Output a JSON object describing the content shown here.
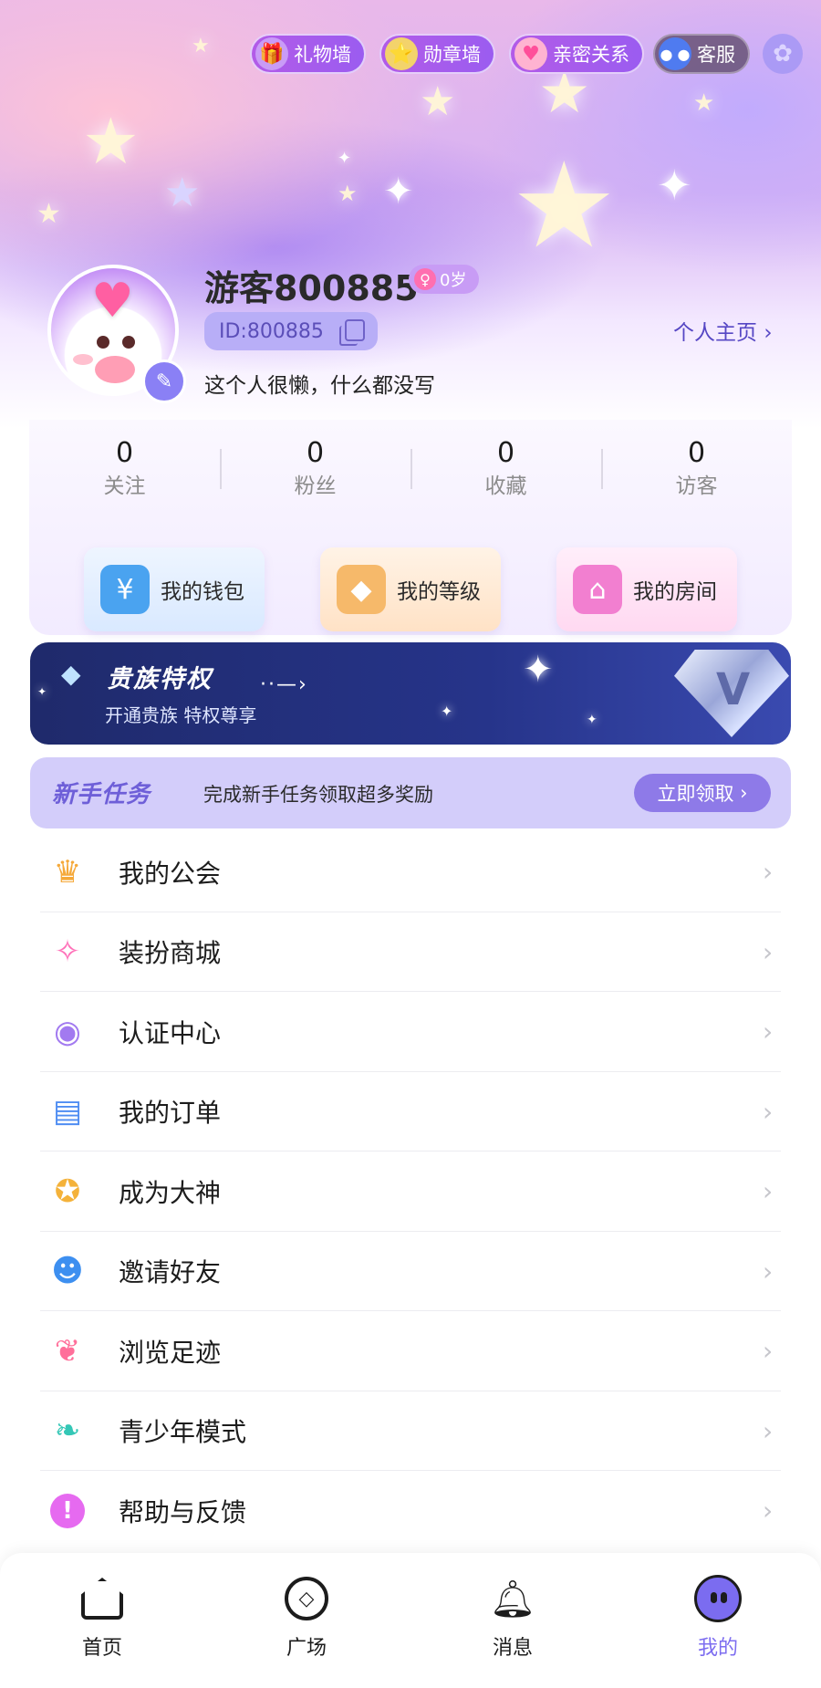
{
  "header_actions": {
    "gift_wall": "礼物墙",
    "medal_wall": "勋章墙",
    "intimacy": "亲密关系",
    "support": "客服"
  },
  "profile": {
    "username": "游客800885",
    "age": "0岁",
    "user_id": "ID:800885",
    "homepage_link": "个人主页",
    "bio": "这个人很懒，什么都没写"
  },
  "stats": [
    {
      "value": "0",
      "label": "关注"
    },
    {
      "value": "0",
      "label": "粉丝"
    },
    {
      "value": "0",
      "label": "收藏"
    },
    {
      "value": "0",
      "label": "访客"
    }
  ],
  "quick_actions": {
    "wallet": "我的钱包",
    "level": "我的等级",
    "room": "我的房间"
  },
  "noble_banner": {
    "title": "贵族特权",
    "subtitle": "开通贵族  特权尊享"
  },
  "newbie_task": {
    "title": "新手任务",
    "description": "完成新手任务领取超多奖励",
    "button": "立即领取"
  },
  "menu": [
    {
      "label": "我的公会",
      "icon": "crown-icon"
    },
    {
      "label": "装扮商城",
      "icon": "magic-wand-icon"
    },
    {
      "label": "认证中心",
      "icon": "medal-icon"
    },
    {
      "label": "我的订单",
      "icon": "clipboard-icon"
    },
    {
      "label": "成为大神",
      "icon": "badge-icon"
    },
    {
      "label": "邀请好友",
      "icon": "invite-friend-icon"
    },
    {
      "label": "浏览足迹",
      "icon": "footprint-icon"
    },
    {
      "label": "青少年模式",
      "icon": "sprout-icon"
    },
    {
      "label": "帮助与反馈",
      "icon": "help-icon"
    }
  ],
  "tabs": [
    {
      "label": "首页"
    },
    {
      "label": "广场"
    },
    {
      "label": "消息"
    },
    {
      "label": "我的"
    }
  ],
  "colors": {
    "accent": "#7d6df0",
    "noble_bg": "#26348a",
    "task_bg": "#d3cdfa"
  }
}
